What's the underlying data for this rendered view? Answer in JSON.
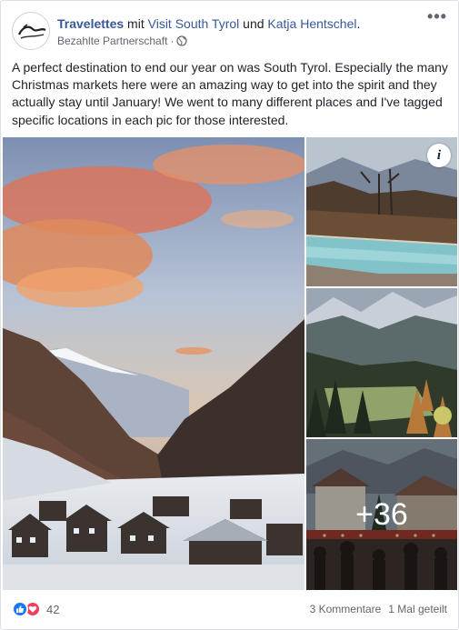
{
  "post": {
    "page_name": "Travelettes",
    "with_word": " mit ",
    "partner_name": "Visit South Tyrol",
    "and_word": " und ",
    "person_name": "Katja Hentschel",
    "period": ".",
    "subtitle": "Bezahlte Partnerschaft",
    "subtitle_sep": "·",
    "avatar_text": "Travelettes",
    "more_label": "•••",
    "text": "A perfect destination to end our year on was South Tyrol. Especially the many Christmas markets here were an amazing way to get into the spirit and they actually stay until January! We went to many different places and I've tagged specific locations in each pic for those interested."
  },
  "photos": {
    "info_label": "i",
    "more_count": "+36"
  },
  "footer": {
    "reaction_count": "42",
    "comments": "3 Kommentare",
    "shares": "1 Mal geteilt"
  },
  "colors": {
    "link": "#385898",
    "like": "#1877f2",
    "love": "#f33e58"
  }
}
